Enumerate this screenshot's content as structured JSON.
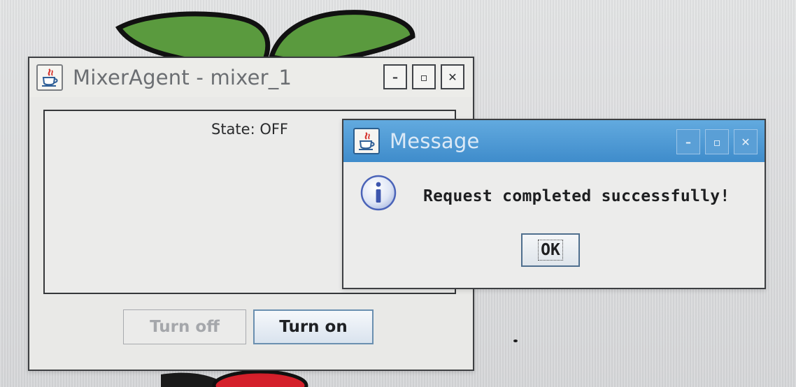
{
  "main_window": {
    "title": "MixerAgent - mixer_1",
    "icon": "java-coffee-icon",
    "controls": {
      "minimize": "–",
      "maximize": "▫",
      "close": "✕"
    },
    "state_label": "State: OFF",
    "turn_off_label": "Turn off",
    "turn_off_enabled": false,
    "turn_on_label": "Turn on"
  },
  "message_dialog": {
    "title": "Message",
    "icon": "java-coffee-icon",
    "controls": {
      "minimize": "–",
      "maximize": "▫",
      "close": "✕"
    },
    "info_icon": "info-icon",
    "text": "Request completed successfully!",
    "ok_label": "OK"
  },
  "wallpaper": {
    "icon": "raspberry-pi-logo-icon",
    "leaf_color": "#5a9a3e",
    "berry_color": "#d4202b"
  },
  "colors": {
    "dialog_titlebar": "#4a98d6",
    "desktop": "#d9dadb"
  }
}
